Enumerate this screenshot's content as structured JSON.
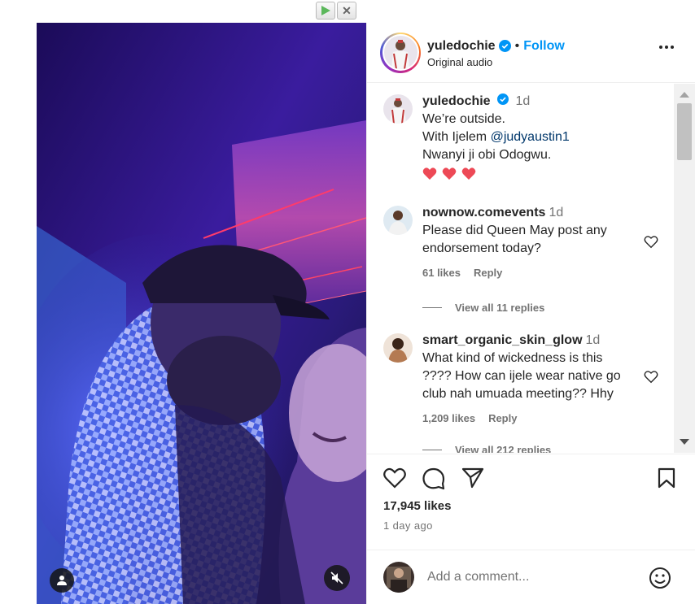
{
  "post": {
    "username": "yuledochie",
    "follow_label": "Follow",
    "separator": "•",
    "audio": "Original audio",
    "more_label": "More options"
  },
  "caption": {
    "username": "yuledochie",
    "ago": "1d",
    "lines": [
      "We’re outside.",
      "With Ijelem",
      "@judyaustin1",
      "Nwanyi ji obi Odogwu."
    ],
    "emojis": "❤️ ❤️ ❤️"
  },
  "comments": [
    {
      "username": "nownow.comevents",
      "ago": "1d",
      "lines": [
        "Please did Queen May post any",
        "endorsement today?"
      ],
      "likes": "61 likes",
      "reply": "Reply",
      "view_replies": "View all 11 replies"
    },
    {
      "username": "smart_organic_skin_glow",
      "ago": "1d",
      "lines": [
        "What kind of wickedness is this",
        "???? How can ijele wear native go",
        "club nah umuada meeting?? Hhy"
      ],
      "likes": "1,209 likes",
      "reply": "Reply",
      "view_replies": "View all 212 replies"
    }
  ],
  "engagement": {
    "likes": "17,945 likes",
    "date": "1 day ago"
  },
  "composer": {
    "placeholder": "Add a comment..."
  },
  "icons": {
    "like": "heart-icon",
    "comment": "comment-bubble-icon",
    "share": "paper-plane-icon",
    "save": "bookmark-icon",
    "emoji": "smiley-icon",
    "mute": "speaker-muted-icon",
    "tag": "user-tag-icon",
    "verified": "verified-badge-icon",
    "play": "play-icon",
    "close": "close-icon"
  },
  "colors": {
    "link": "#0095f6",
    "mention": "#00376b",
    "heart": "#ed4956",
    "secondary_text": "#737373"
  }
}
